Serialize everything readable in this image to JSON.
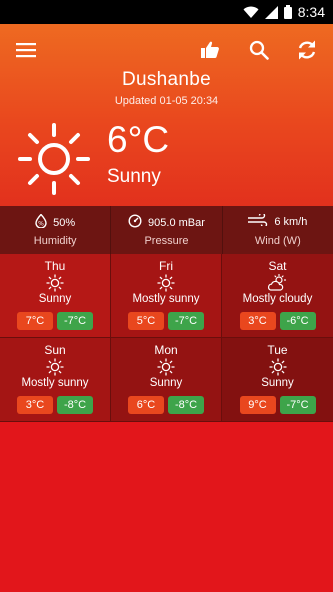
{
  "status_bar": {
    "time": "8:34"
  },
  "toolbar": {
    "menu_icon": "hamburger-menu-icon",
    "like_icon": "thumbs-up-icon",
    "search_icon": "search-icon",
    "refresh_icon": "refresh-icon"
  },
  "current": {
    "city": "Dushanbe",
    "updated": "Updated 01-05 20:34",
    "temp": "6°C",
    "condition": "Sunny",
    "icon": "sun-icon"
  },
  "metrics": [
    {
      "value": "50%",
      "label": "Humidity",
      "icon": "humidity-icon"
    },
    {
      "value": "905.0 mBar",
      "label": "Pressure",
      "icon": "pressure-icon"
    },
    {
      "value": "6 km/h",
      "label": "Wind (W)",
      "icon": "wind-icon"
    }
  ],
  "forecast": [
    {
      "day": "Thu",
      "condition": "Sunny",
      "high": "7°C",
      "low": "-7°C",
      "icon": "sun-icon"
    },
    {
      "day": "Fri",
      "condition": "Mostly sunny",
      "high": "5°C",
      "low": "-7°C",
      "icon": "sun-icon"
    },
    {
      "day": "Sat",
      "condition": "Mostly cloudy",
      "high": "3°C",
      "low": "-6°C",
      "icon": "partly-cloudy-icon"
    },
    {
      "day": "Sun",
      "condition": "Mostly sunny",
      "high": "3°C",
      "low": "-8°C",
      "icon": "sun-icon"
    },
    {
      "day": "Mon",
      "condition": "Sunny",
      "high": "6°C",
      "low": "-8°C",
      "icon": "sun-icon"
    },
    {
      "day": "Tue",
      "condition": "Sunny",
      "high": "9°C",
      "low": "-7°C",
      "icon": "sun-icon"
    }
  ],
  "colors": {
    "header_top": "#ee6a21",
    "header_bottom": "#e2311d",
    "metrics_bg": "#6d1512",
    "page_bg": "#e2161b",
    "high_pill": "#e9471e",
    "low_pill": "#3ea44a"
  }
}
